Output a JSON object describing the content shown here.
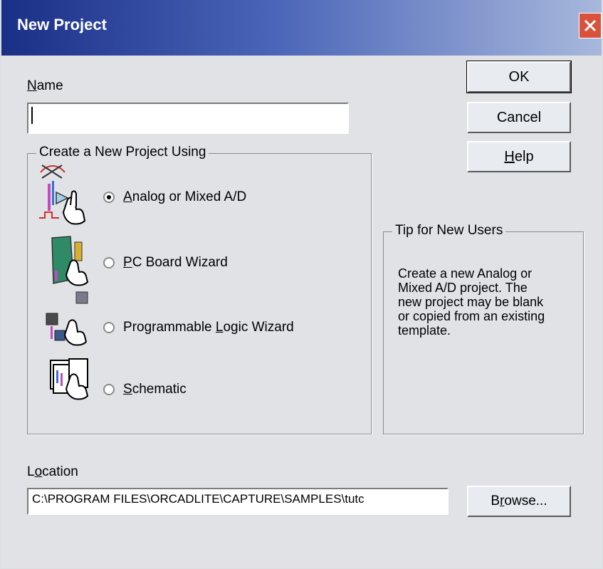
{
  "window": {
    "title": "New Project"
  },
  "name": {
    "label_u": "N",
    "label_rest": "ame",
    "value": ""
  },
  "buttons": {
    "ok": "OK",
    "cancel": "Cancel",
    "help_u": "H",
    "help_rest": "elp",
    "browse_pre": "B",
    "browse_u": "r",
    "browse_post": "owse..."
  },
  "project_group": {
    "legend": "Create a New Project Using",
    "options": [
      {
        "pre": "",
        "u": "A",
        "post": "nalog or Mixed A/D",
        "checked": true,
        "icon": "analog-mixed-icon"
      },
      {
        "pre": "",
        "u": "P",
        "post": "C Board Wizard",
        "checked": false,
        "icon": "pc-board-icon"
      },
      {
        "pre": "Programmable ",
        "u": "L",
        "post": "ogic Wizard",
        "checked": false,
        "icon": "programmable-logic-icon"
      },
      {
        "pre": "",
        "u": "S",
        "post": "chematic",
        "checked": false,
        "icon": "schematic-icon"
      }
    ]
  },
  "tip": {
    "legend": "Tip for New Users",
    "lines": [
      "Create a new Analog or",
      "Mixed A/D project.  The",
      "new project may be blank",
      "or copied from an existing",
      "template."
    ]
  },
  "location": {
    "label_pre": "L",
    "label_u": "o",
    "label_post": "cation",
    "value": "C:\\PROGRAM FILES\\ORCADLITE\\CAPTURE\\SAMPLES\\tutc"
  },
  "colors": {
    "title_bar": "#1a2f86",
    "close_button": "#d9513b",
    "dialog_bg": "#e0e2e6"
  }
}
